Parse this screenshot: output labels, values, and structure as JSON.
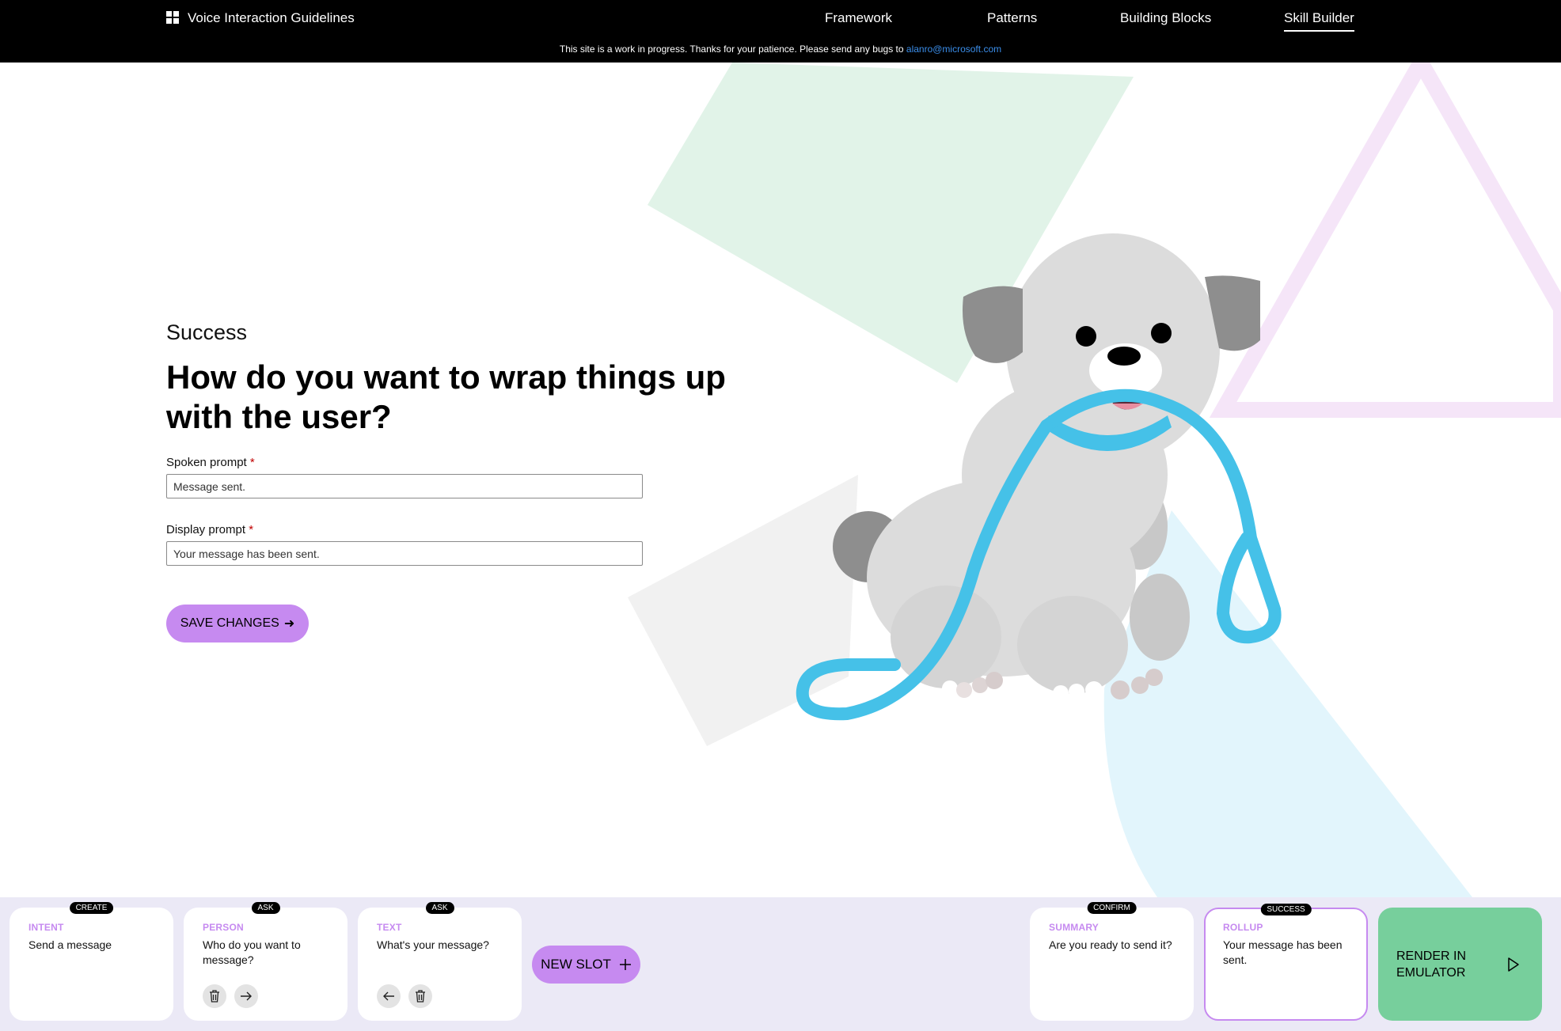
{
  "header": {
    "brand": "Voice Interaction Guidelines",
    "nav": [
      {
        "label": "Framework",
        "active": false
      },
      {
        "label": "Patterns",
        "active": false
      },
      {
        "label": "Building Blocks",
        "active": false
      },
      {
        "label": "Skill Builder",
        "active": true
      }
    ],
    "notice_text": "This site is a work in progress. Thanks for your patience. Please send any bugs to ",
    "notice_email": "alanro@microsoft.com"
  },
  "form": {
    "eyebrow": "Success",
    "heading": "How do you want to wrap things up with the user?",
    "spoken_label": "Spoken prompt",
    "spoken_value": "Message sent.",
    "display_label": "Display prompt",
    "display_value": "Your message has been sent.",
    "required_mark": "*",
    "save_label": "SAVE CHANGES",
    "save_arrow": "➜"
  },
  "tray": {
    "cards": [
      {
        "tag": "CREATE",
        "type": "INTENT",
        "text": "Send a message"
      },
      {
        "tag": "ASK",
        "type": "PERSON",
        "text": "Who do you want to message?"
      },
      {
        "tag": "ASK",
        "type": "TEXT",
        "text": "What's your message?"
      },
      {
        "tag": "CONFIRM",
        "type": "SUMMARY",
        "text": "Are you ready to send it?"
      },
      {
        "tag": "SUCCESS",
        "type": "ROLLUP",
        "text": "Your message has been sent."
      }
    ],
    "new_slot_label": "NEW SLOT",
    "render_label": "RENDER IN EMULATOR"
  },
  "colors": {
    "accent": "#c68af0",
    "render": "#77cf9c",
    "tray_bg": "#ebe9f6",
    "leash": "#45c1e8",
    "dog": "#dcdcdc",
    "dog_ears": "#8e8e8e"
  },
  "icons": {
    "logo": "windows-logo-icon",
    "delete": "trash-icon",
    "next": "arrow-right-icon",
    "back": "arrow-left-icon",
    "add": "plus-icon",
    "play": "play-icon"
  }
}
